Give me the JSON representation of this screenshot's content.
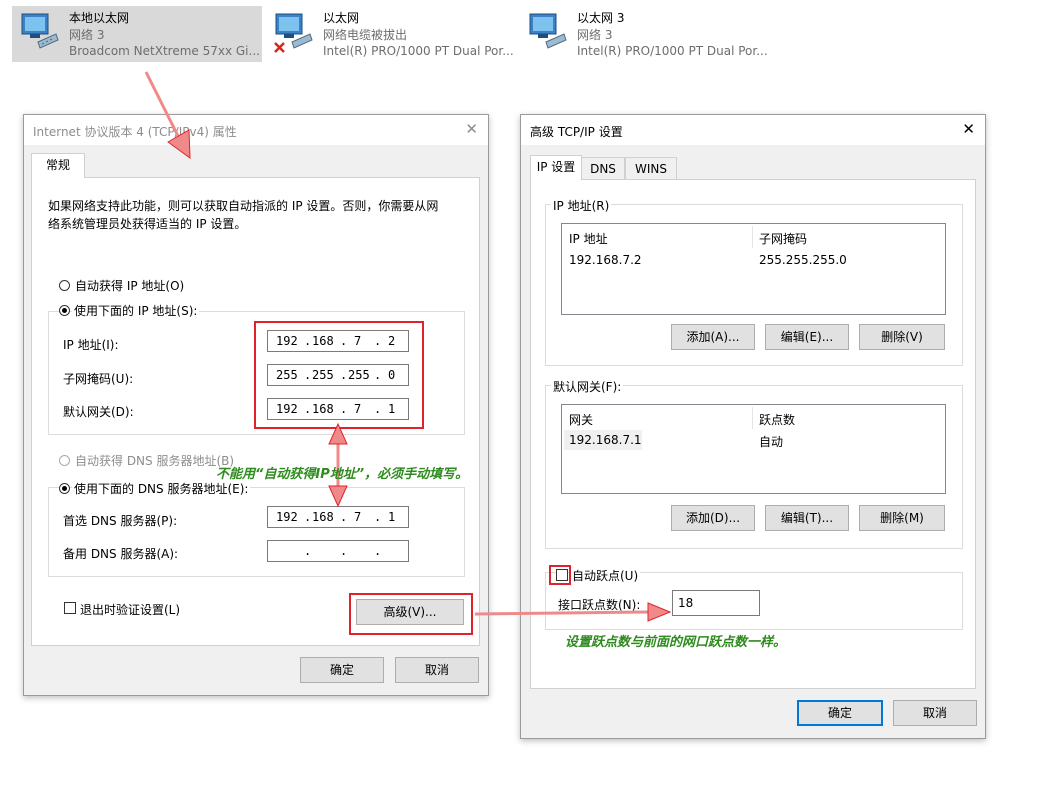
{
  "adapters": [
    {
      "name": "本地以太网",
      "status": "网络 3",
      "device": "Broadcom NetXtreme 57xx Gi...",
      "selected": true,
      "icon": "network-adapter-icon"
    },
    {
      "name": "以太网",
      "status": "网络电缆被拔出",
      "device": "Intel(R) PRO/1000 PT Dual Por...",
      "selected": false,
      "icon": "network-adapter-disconnected-icon"
    },
    {
      "name": "以太网 3",
      "status": "网络 3",
      "device": "Intel(R) PRO/1000 PT Dual Por...",
      "selected": false,
      "icon": "network-adapter-icon"
    }
  ],
  "ipv4_dialog": {
    "title": "Internet 协议版本 4 (TCP/IPv4) 属性",
    "tab": "常规",
    "description_line1": "如果网络支持此功能，则可以获取自动指派的 IP 设置。否则，你需要从网",
    "description_line2": "络系统管理员处获得适当的 IP 设置。",
    "auto_ip_label": "自动获得 IP 地址(O)",
    "manual_ip_label": "使用下面的 IP 地址(S):",
    "ip_label": "IP 地址(I):",
    "ip": [
      "192",
      "168",
      "7",
      "2"
    ],
    "mask_label": "子网掩码(U):",
    "mask": [
      "255",
      "255",
      "255",
      "0"
    ],
    "gateway_label": "默认网关(D):",
    "gateway": [
      "192",
      "168",
      "7",
      "1"
    ],
    "auto_dns_label": "自动获得 DNS 服务器地址(B)",
    "manual_dns_label": "使用下面的 DNS 服务器地址(E):",
    "preferred_dns_label": "首选 DNS 服务器(P):",
    "preferred_dns": [
      "192",
      "168",
      "7",
      "1"
    ],
    "alternate_dns_label": "备用 DNS 服务器(A):",
    "alternate_dns": [
      "",
      "",
      "",
      ""
    ],
    "validate_label": "退出时验证设置(L)",
    "advanced_button": "高级(V)...",
    "ok_button": "确定",
    "cancel_button": "取消"
  },
  "advanced_dialog": {
    "title": "高级 TCP/IP 设置",
    "tabs": [
      "IP 设置",
      "DNS",
      "WINS"
    ],
    "ip_group_label": "IP 地址(R)",
    "ip_columns": [
      "IP 地址",
      "子网掩码"
    ],
    "ip_rows": [
      [
        "192.168.7.2",
        "255.255.255.0"
      ]
    ],
    "ip_add": "添加(A)...",
    "ip_edit": "编辑(E)...",
    "ip_remove": "删除(V)",
    "gateway_group_label": "默认网关(F):",
    "gateway_columns": [
      "网关",
      "跃点数"
    ],
    "gateway_rows": [
      [
        "192.168.7.1",
        "自动"
      ]
    ],
    "gw_add": "添加(D)...",
    "gw_edit": "编辑(T)...",
    "gw_remove": "删除(M)",
    "auto_metric_label": "自动跃点(U)",
    "interface_metric_label": "接口跃点数(N):",
    "interface_metric_value": "18",
    "ok_button": "确定",
    "cancel_button": "取消"
  },
  "annotations": {
    "note1": "不能用“自动获得IP地址”，必须手动填写。",
    "note2": "设置跃点数与前面的网口跃点数一样。",
    "highlight_color": "#e0232a",
    "note_color": "#2e8b1e"
  }
}
